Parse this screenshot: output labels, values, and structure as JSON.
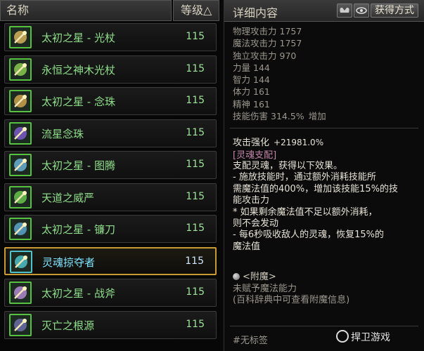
{
  "list": {
    "header_name": "名称",
    "header_level": "等级△",
    "items": [
      {
        "name": "太初之星 - 光杖",
        "level": "115",
        "icon": "staff-icon",
        "color": "#d5b25a"
      },
      {
        "name": "永恒之神木光杖",
        "level": "115",
        "icon": "wood-staff-icon",
        "color": "#8bc84f"
      },
      {
        "name": "太初之星 - 念珠",
        "level": "115",
        "icon": "beads-icon",
        "color": "#caa34c"
      },
      {
        "name": "流星念珠",
        "level": "115",
        "icon": "meteor-beads-icon",
        "color": "#7a5cc9"
      },
      {
        "name": "太初之星 - 图腾",
        "level": "115",
        "icon": "totem-icon",
        "color": "#6ab0d6"
      },
      {
        "name": "天道之威严",
        "level": "115",
        "icon": "heaven-icon",
        "color": "#68c44d"
      },
      {
        "name": "太初之星 - 镰刀",
        "level": "115",
        "icon": "scythe-icon",
        "color": "#5aa6c9"
      },
      {
        "name": "灵魂掠夺者",
        "level": "115",
        "icon": "soul-reaper-icon",
        "color": "#4ec0c6"
      },
      {
        "name": "太初之星 - 战斧",
        "level": "115",
        "icon": "battle-axe-icon",
        "color": "#b08ad0"
      },
      {
        "name": "灭亡之根源",
        "level": "115",
        "icon": "doom-root-icon",
        "color": "#6b6fa8"
      }
    ],
    "selected_index": 7
  },
  "detail": {
    "title": "详细内容",
    "acquire_label": "获得方式",
    "stats": [
      {
        "label": "物理攻击力",
        "value": "1757"
      },
      {
        "label": "魔法攻击力",
        "value": "1757"
      },
      {
        "label": "独立攻击力",
        "value": "970"
      },
      {
        "label": "力量",
        "value": "144"
      },
      {
        "label": "智力",
        "value": "144"
      },
      {
        "label": "体力",
        "value": "161"
      },
      {
        "label": "精神",
        "value": "161"
      }
    ],
    "skill_damage_label": "技能伤害",
    "skill_damage_value": "314.5%",
    "skill_damage_suffix": "增加",
    "enhance_label": "攻击强化",
    "enhance_value": "+21981.0%",
    "soul_title": "[灵魂支配]",
    "desc_lines": [
      "支配灵魂，获得以下效果。",
      "- 施放技能时，通过额外消耗技能所",
      "需魔法值的400%，增加该技能15%的技",
      "能攻击力",
      " * 如果剩余魔法值不足以额外消耗，",
      "则不会发动",
      "- 每6秒吸收敌人的灵魂，恢复15%的",
      "魔法值"
    ],
    "enchant_title": "<附魔>",
    "enchant_line1": "未赋予魔法能力",
    "enchant_line2": "(百科辞典中可查看附魔信息)",
    "tag": "#无标签"
  },
  "watermark": "捍卫游戏"
}
